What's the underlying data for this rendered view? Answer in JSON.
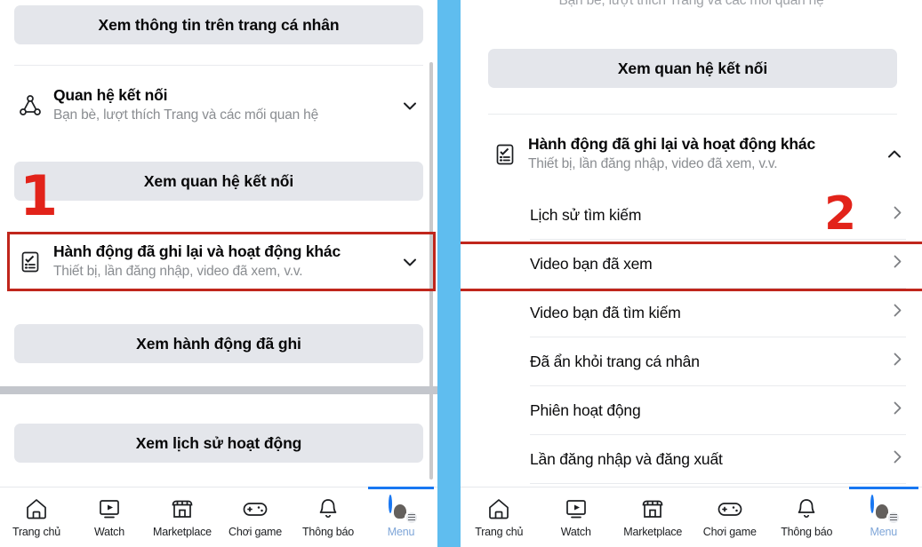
{
  "left_panel": {
    "profile_button": "Xem thông tin trên trang cá nhân",
    "connections_row": {
      "icon": "network-nodes-icon",
      "title": "Quan hệ kết nối",
      "subtitle": "Bạn bè, lượt thích Trang và các mối quan hệ",
      "chevron": "chevron-down-icon"
    },
    "connections_button": "Xem quan hệ kết nối",
    "activity_row": {
      "icon": "clipboard-check-icon",
      "title": "Hành động đã ghi lại và hoạt động khác",
      "subtitle": "Thiết bị, lần đăng nhập, video đã xem, v.v.",
      "chevron": "chevron-down-icon"
    },
    "activity_button": "Xem hành động đã ghi",
    "history_button": "Xem lịch sử hoạt động",
    "annotation": "1"
  },
  "right_panel": {
    "cut_off_subtitle": "Bạn bè, lượt thích Trang và các mối quan hệ",
    "connections_button": "Xem quan hệ kết nối",
    "activity_row": {
      "icon": "clipboard-check-icon",
      "title": "Hành động đã ghi lại và hoạt động khác",
      "subtitle": "Thiết bị, lần đăng nhập, video đã xem, v.v.",
      "chevron": "chevron-up-icon"
    },
    "list_items": [
      {
        "label": "Lịch sử tìm kiếm",
        "chevron": "chevron-right-icon"
      },
      {
        "label": "Video bạn đã xem",
        "chevron": "chevron-right-icon"
      },
      {
        "label": "Video bạn đã tìm kiếm",
        "chevron": "chevron-right-icon"
      },
      {
        "label": "Đã ẩn khỏi trang cá nhân",
        "chevron": "chevron-right-icon"
      },
      {
        "label": "Phiên hoạt động",
        "chevron": "chevron-right-icon"
      },
      {
        "label": "Lần đăng nhập và đăng xuất",
        "chevron": "chevron-right-icon"
      }
    ],
    "annotation": "2"
  },
  "bottom_nav": {
    "items": [
      {
        "label": "Trang chủ",
        "icon": "home-icon",
        "active": false
      },
      {
        "label": "Watch",
        "icon": "video-play-icon",
        "active": false
      },
      {
        "label": "Marketplace",
        "icon": "storefront-icon",
        "active": false
      },
      {
        "label": "Chơi game",
        "icon": "gamepad-icon",
        "active": false
      },
      {
        "label": "Thông báo",
        "icon": "bell-icon",
        "active": false
      },
      {
        "label": "Menu",
        "icon": "avatar-menu-icon",
        "active": true
      }
    ]
  },
  "colors": {
    "accent_blue": "#1877f2",
    "divider_blue": "#5fbdef",
    "annotation_red": "#e2231a",
    "highlight_box_red": "#c0261c",
    "button_gray": "#e4e6eb",
    "subtitle_gray": "#8a8d91"
  }
}
